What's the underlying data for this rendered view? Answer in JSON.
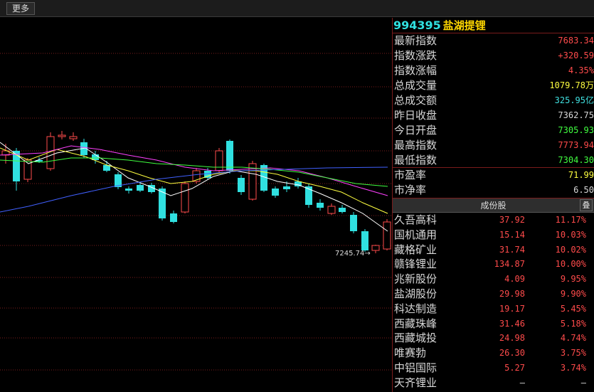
{
  "toolbar": {
    "more_label": "更多"
  },
  "index": {
    "code": "994395",
    "name": "盐湖提锂"
  },
  "quote": [
    {
      "label": "最新指数",
      "value": "7683.34",
      "color": "#ff4b4b"
    },
    {
      "label": "指数涨跌",
      "value": "+320.59",
      "color": "#ff4b4b"
    },
    {
      "label": "指数涨幅",
      "value": "4.35%",
      "color": "#ff4b4b"
    },
    {
      "label": "总成交量",
      "value": "1079.78万",
      "color": "#ffff40"
    },
    {
      "label": "总成交额",
      "value": "325.95亿",
      "color": "#40e0e0"
    },
    {
      "label": "昨日收盘",
      "value": "7362.75",
      "color": "#d8d8d8"
    },
    {
      "label": "今日开盘",
      "value": "7305.93",
      "color": "#40ff40"
    },
    {
      "label": "最高指数",
      "value": "7773.94",
      "color": "#ff4b4b"
    },
    {
      "label": "最低指数",
      "value": "7304.30",
      "color": "#40ff40"
    }
  ],
  "valuation": [
    {
      "label": "市盈率",
      "value": "71.99",
      "color": "#ffff40"
    },
    {
      "label": "市净率",
      "value": "6.50",
      "color": "#d8d8d8"
    }
  ],
  "stocks_header": {
    "title": "成份股",
    "stack_label": "叠"
  },
  "stocks": [
    {
      "name": "久吾高科",
      "price": "37.92",
      "pct": "11.17%"
    },
    {
      "name": "国机通用",
      "price": "15.14",
      "pct": "10.03%"
    },
    {
      "name": "藏格矿业",
      "price": "31.74",
      "pct": "10.02%"
    },
    {
      "name": "赣锋锂业",
      "price": "134.87",
      "pct": "10.00%"
    },
    {
      "name": "兆新股份",
      "price": "4.09",
      "pct": "9.95%"
    },
    {
      "name": "盐湖股份",
      "price": "29.98",
      "pct": "9.90%"
    },
    {
      "name": "科达制造",
      "price": "19.17",
      "pct": "5.45%"
    },
    {
      "name": "西藏珠峰",
      "price": "31.46",
      "pct": "5.18%"
    },
    {
      "name": "西藏城投",
      "price": "24.98",
      "pct": "4.74%"
    },
    {
      "name": "唯赛勃",
      "price": "26.30",
      "pct": "3.75%"
    },
    {
      "name": "中铝国际",
      "price": "5.27",
      "pct": "3.74%"
    },
    {
      "name": "天齐锂业",
      "price": "—",
      "pct": "—"
    }
  ],
  "chart_data": {
    "type": "candlestick",
    "low_marker": "7245.74",
    "colors": {
      "up": "#ff4b4b",
      "down": "#30e0e0",
      "ma5": "#ffffff",
      "ma10": "#ffff40",
      "ma20": "#ff40ff",
      "ma30": "#40ff40",
      "ma60": "#4060ff"
    }
  }
}
